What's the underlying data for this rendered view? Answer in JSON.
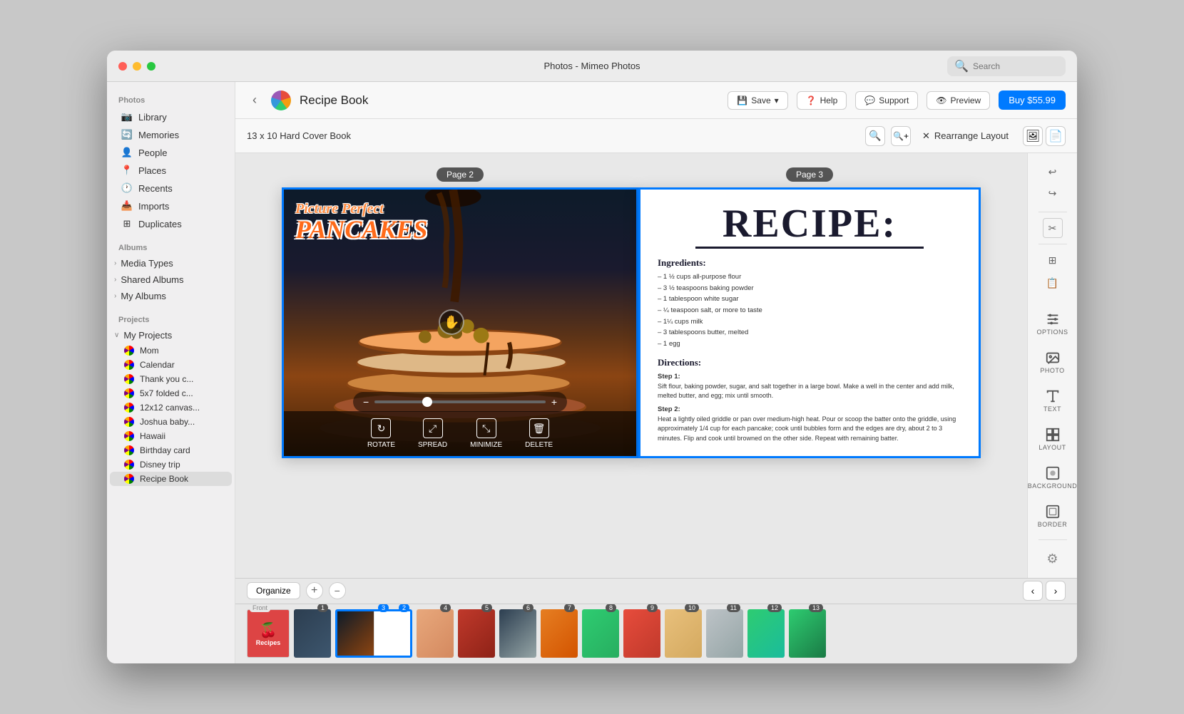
{
  "window": {
    "title": "Photos - Mimeo Photos",
    "traffic_lights": [
      "red",
      "yellow",
      "green"
    ]
  },
  "header": {
    "back_label": "‹",
    "app_title": "Recipe Book",
    "save_label": "Save",
    "help_label": "Help",
    "support_label": "Support",
    "preview_label": "Preview",
    "buy_label": "Buy $55.99"
  },
  "toolbar": {
    "book_size": "13 x 10 Hard Cover Book",
    "zoom_in_label": "+",
    "zoom_out_label": "−",
    "rearrange_label": "Rearrange Layout"
  },
  "search": {
    "placeholder": "Search"
  },
  "sidebar": {
    "photos_section": "Photos",
    "photos_items": [
      {
        "label": "Library",
        "icon": "📷"
      },
      {
        "label": "Memories",
        "icon": "🔄"
      },
      {
        "label": "People",
        "icon": "👤"
      },
      {
        "label": "Places",
        "icon": "📍"
      },
      {
        "label": "Recents",
        "icon": "🕐"
      },
      {
        "label": "Imports",
        "icon": "📥"
      },
      {
        "label": "Duplicates",
        "icon": "⊞"
      }
    ],
    "albums_section": "Albums",
    "albums_items": [
      {
        "label": "Media Types"
      },
      {
        "label": "Shared Albums"
      },
      {
        "label": "My Albums"
      }
    ],
    "projects_section": "Projects",
    "projects_label": "My Projects",
    "project_items": [
      {
        "label": "Mom"
      },
      {
        "label": "Calendar"
      },
      {
        "label": "Thank you c..."
      },
      {
        "label": "5x7 folded c..."
      },
      {
        "label": "12x12 canvas..."
      },
      {
        "label": "Joshua baby..."
      },
      {
        "label": "Hawaii"
      },
      {
        "label": "Birthday card"
      },
      {
        "label": "Disney trip"
      },
      {
        "label": "Recipe Book"
      }
    ]
  },
  "pages": {
    "page2_label": "Page 2",
    "page3_label": "Page 3"
  },
  "recipe_page": {
    "title": "RECIPE:",
    "ingredients_header": "Ingredients:",
    "ingredients_text": "– 1 ½ cups all-purpose flour\n– 3 ½ teaspoons baking powder\n– 1 tablespoon white sugar\n– ¼ teaspoon salt, or more to taste\n– 1¼ cups milk\n– 3 tablespoons butter, melted\n– 1 egg",
    "directions_header": "Directions:",
    "step1_label": "Step 1:",
    "step1_text": "Sift flour, baking powder, sugar, and salt together in a large bowl. Make a well in the center and add milk, melted butter, and egg; mix until smooth.",
    "step2_label": "Step 2:",
    "step2_text": "Heat a lightly oiled griddle or pan over medium-high heat. Pour or scoop the batter onto the griddle, using approximately 1/4 cup for each pancake; cook until bubbles form and the edges are dry, about 2 to 3 minutes. Flip and cook until browned on the other side. Repeat with remaining batter."
  },
  "right_panel": {
    "options_label": "OPTIONS",
    "photo_label": "PHOTO",
    "text_label": "TEXT",
    "layout_label": "LAYOUT",
    "background_label": "BACKGROUND",
    "border_label": "BORDER"
  },
  "filmstrip": {
    "organize_label": "Organize",
    "front_label": "Front",
    "page_count": 13,
    "selected_pages": [
      2,
      3
    ]
  },
  "photo_actions": {
    "rotate_label": "ROTATE",
    "spread_label": "SPREAD",
    "minimize_label": "MINIMIZE",
    "delete_label": "DELETE"
  }
}
